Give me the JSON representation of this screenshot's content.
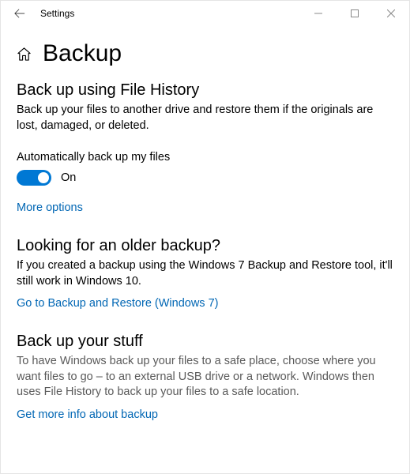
{
  "window": {
    "title": "Settings"
  },
  "page": {
    "title": "Backup"
  },
  "section1": {
    "heading": "Back up using File History",
    "desc": "Back up your files to another drive and restore them if the originals are lost, damaged, or deleted.",
    "toggle_label": "Automatically back up my files",
    "toggle_state": "On",
    "link": "More options"
  },
  "section2": {
    "heading": "Looking for an older backup?",
    "desc": "If you created a backup using the Windows 7 Backup and Restore tool, it'll still work in Windows 10.",
    "link": "Go to Backup and Restore (Windows 7)"
  },
  "section3": {
    "heading": "Back up your stuff",
    "desc": "To have Windows back up your files to a safe place, choose where you want files to go – to an external USB drive or a network. Windows then uses File History to back up your files to a safe location.",
    "link": "Get more info about backup"
  }
}
